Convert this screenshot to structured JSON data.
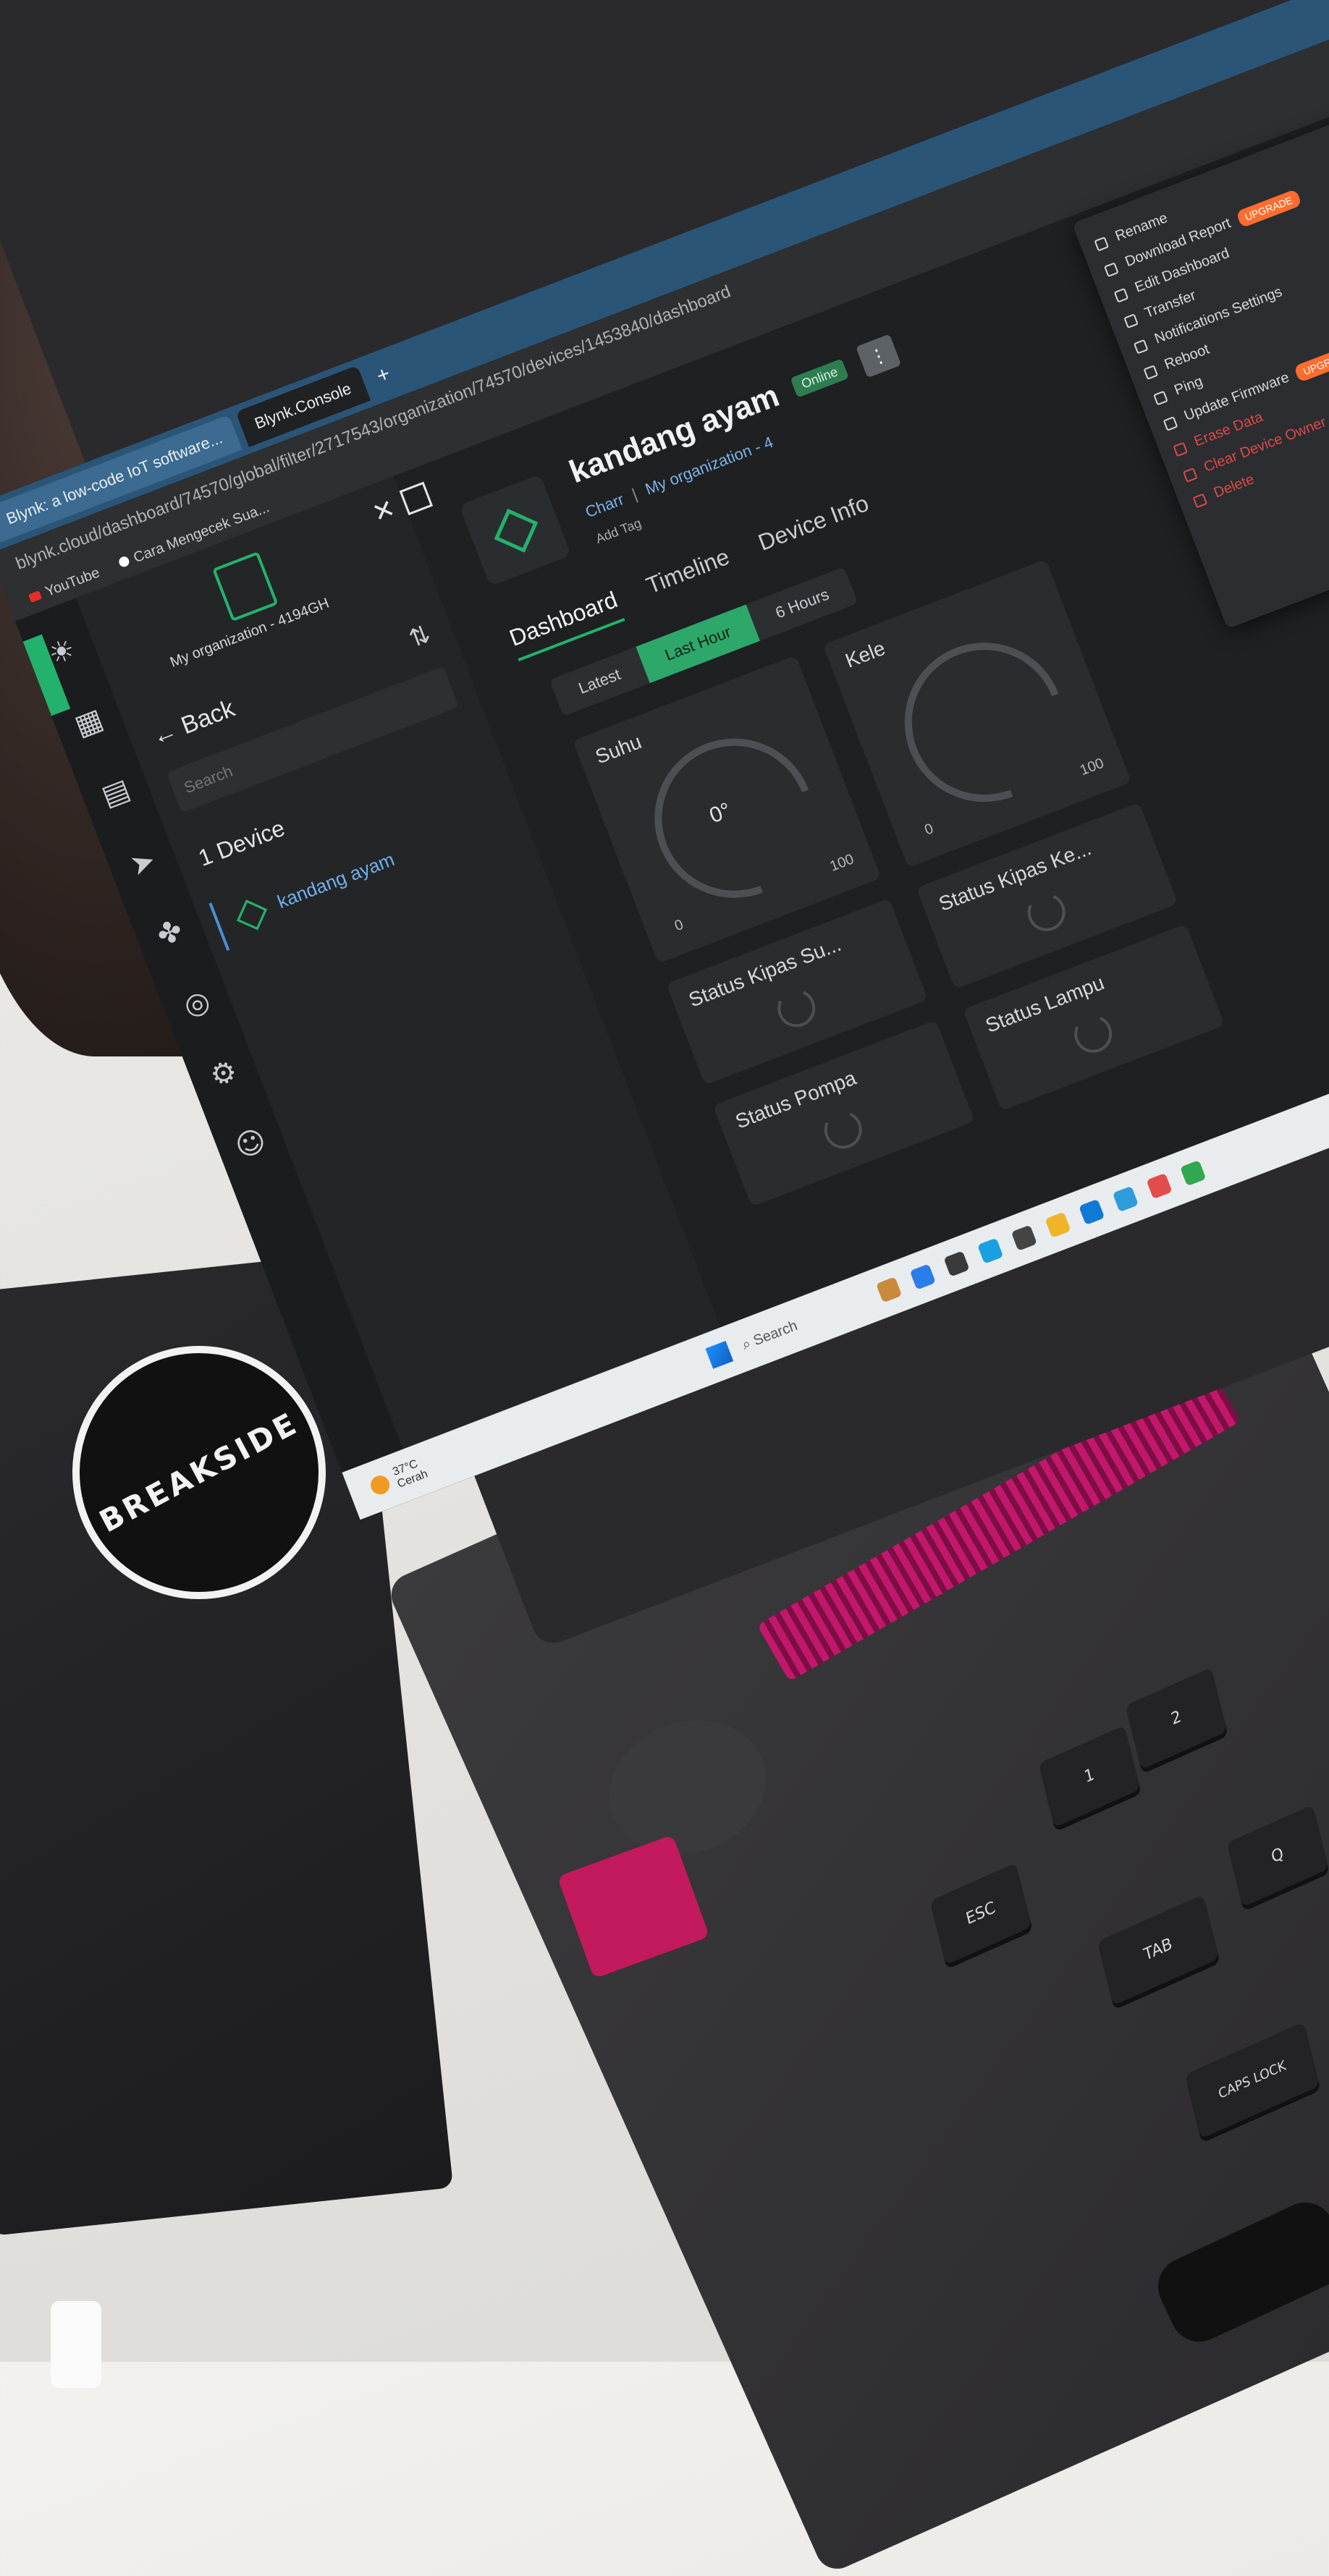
{
  "browser": {
    "tabs": [
      {
        "label": "Blynk: a low-code IoT software..."
      },
      {
        "label": "Blynk.Console"
      }
    ],
    "new_tab": "+",
    "url": "blynk.cloud/dashboard/74570/global/filter/2717543/organization/74570/devices/1453840/dashboard",
    "bookmarks": [
      {
        "label": "YouTube"
      },
      {
        "label": "Cara Mengecek Sua..."
      }
    ]
  },
  "rail": {
    "icons": [
      "sun-icon",
      "grid-icon",
      "document-icon",
      "send-icon",
      "pets-icon",
      "target-icon",
      "settings-icon",
      "user-icon"
    ]
  },
  "sidebar": {
    "org_name": "My organization - 4194GH",
    "back_label": "← Back",
    "search_placeholder": "Search",
    "device_count": "1 Device",
    "devices": [
      {
        "name": "kandang ayam"
      }
    ]
  },
  "device": {
    "title": "kandang ayam",
    "status": "Online",
    "menu_label": "⋮",
    "owner": "Charr",
    "org": "My organization - 4",
    "add_tag": "Add Tag"
  },
  "tabs": [
    {
      "label": "Dashboard",
      "active": true
    },
    {
      "label": "Timeline",
      "active": false
    },
    {
      "label": "Device Info",
      "active": false
    }
  ],
  "time_ranges": [
    {
      "label": "Latest",
      "active": false
    },
    {
      "label": "Last Hour",
      "active": true
    },
    {
      "label": "6 Hours",
      "active": false
    }
  ],
  "widgets": {
    "gauge1": {
      "label": "Suhu",
      "value": "0",
      "unit": "°",
      "min": "0",
      "max": "100"
    },
    "status1": {
      "label": "Status Kipas Su..."
    },
    "status2": {
      "label": "Status Pompa"
    },
    "gauge2": {
      "label": "Kele",
      "min": "0",
      "max": "100"
    },
    "status3": {
      "label": "Status Kipas Ke..."
    },
    "status4": {
      "label": "Status Lampu"
    }
  },
  "context_menu": {
    "items": [
      {
        "label": "Rename",
        "danger": false
      },
      {
        "label": "Download Report",
        "danger": false,
        "badge": "UPGRADE"
      },
      {
        "label": "Edit Dashboard",
        "danger": false
      },
      {
        "label": "Transfer",
        "danger": false
      },
      {
        "label": "Notifications Settings",
        "danger": false
      },
      {
        "label": "Reboot",
        "danger": false
      },
      {
        "label": "Ping",
        "danger": false
      },
      {
        "label": "Update Firmware",
        "danger": false,
        "badge": "UPGRADE"
      },
      {
        "label": "Erase Data",
        "danger": true
      },
      {
        "label": "Clear Device Owner",
        "danger": true
      },
      {
        "label": "Delete",
        "danger": true
      }
    ]
  },
  "taskbar": {
    "weather_temp": "37°C",
    "weather_desc": "Cerah",
    "search_placeholder": "Search"
  },
  "sticker": {
    "text": "BREAKSIDE"
  },
  "keys": [
    "ESC",
    "1",
    "2",
    "TAB",
    "CAPS LOCK",
    "Q"
  ],
  "colors": {
    "accent": "#23b26d",
    "link": "#6fb0ef",
    "tabbar": "#2b5577",
    "upgrade": "#ff6d2e",
    "laptop_accent": "#c2186b"
  }
}
